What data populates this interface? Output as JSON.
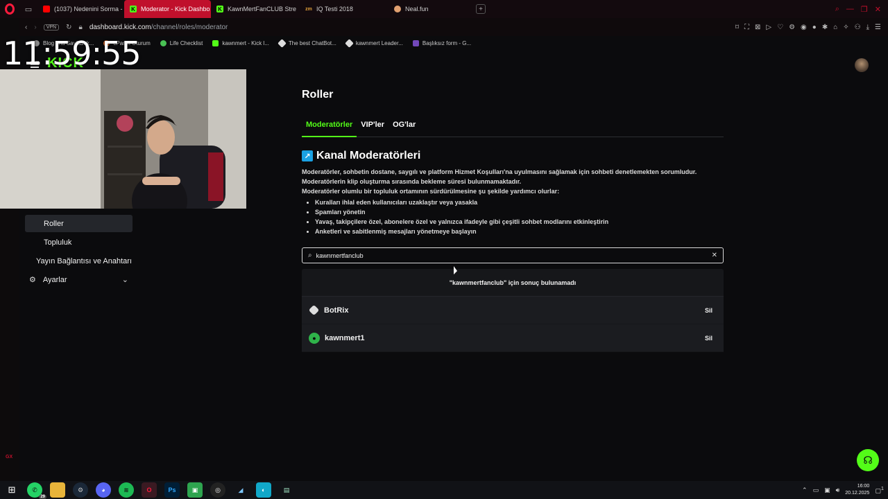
{
  "browser": {
    "tabs": [
      {
        "label": "(1037) Nedenini Sorma -",
        "icon": "youtube-icon",
        "active": false
      },
      {
        "label": "Moderator - Kick Dashbo",
        "icon": "kick-icon",
        "active": true
      },
      {
        "label": "KawnMertFanCLUB Stre",
        "icon": "kick-icon",
        "active": false
      },
      {
        "label": "IQ Testi 2018",
        "icon": "iq-icon",
        "active": false
      },
      {
        "label": "Neal.fun",
        "icon": "neal-icon",
        "active": false
      }
    ],
    "vpn_label": "VPN",
    "url_host": "dashboard.kick.com",
    "url_path": "/channel/roles/moderator",
    "bookmarks": [
      "Blog ana Sayfası k...",
      "cPanel Oturum",
      "Life Checklist",
      "kawnmert - Kick l...",
      "The best ChatBot...",
      "kawnmert Leader...",
      "Başlıksız form - G..."
    ],
    "gx_label": "GX",
    "accent": "#c0102c"
  },
  "overlay": {
    "clock": "11:59:55"
  },
  "kick": {
    "logo_text": "KICK",
    "brand_color": "#53fc18"
  },
  "sidenav": {
    "items": [
      {
        "label": "Roller",
        "active": true
      },
      {
        "label": "Topluluk",
        "active": false
      },
      {
        "label": "Yayın Bağlantısı ve Anahtarı",
        "active": false
      },
      {
        "label": "Ayarlar",
        "active": false
      }
    ]
  },
  "main": {
    "title": "Roller",
    "tabs": [
      "Moderatörler",
      "VIP'ler",
      "OG'lar"
    ],
    "section_title": "Kanal Moderatörleri",
    "description": [
      "Moderatörler, sohbetin dostane, saygılı ve platform Hizmet Koşulları'na uyulmasını sağlamak için sohbeti denetlemekten sorumludur.",
      "Moderatörlerin klip oluşturma sırasında bekleme süresi bulunmamaktadır.",
      "Moderatörler olumlu bir topluluk ortamının sürdürülmesine şu şekilde yardımcı olurlar:"
    ],
    "bullets": [
      "Kuralları ihlal eden kullanıcıları uzaklaştır veya yasakla",
      "Spamları yönetin",
      "Yavaş, takipçilere özel, abonelere özel ve yalnızca ifadeyle gibi çeşitli sohbet modlarını etkinleştirin",
      "Anketleri ve sabitlenmiş mesajları yönetmeye başlayın"
    ],
    "search_value": "kawnmertfanclub",
    "no_result_text": "\"kawnmertfanclub\" için sonuç bulunamadı",
    "moderators": [
      {
        "name": "BotRix",
        "remove_label": "Sil",
        "icon": "botrix-icon"
      },
      {
        "name": "kawnmert1",
        "remove_label": "Sil",
        "icon": "user-avatar-icon"
      }
    ]
  },
  "taskbar": {
    "whatsapp_badge": "29",
    "photoshop_label": "Ps",
    "time": "16:00",
    "date": "20.12.2025",
    "notification_count": "1"
  }
}
